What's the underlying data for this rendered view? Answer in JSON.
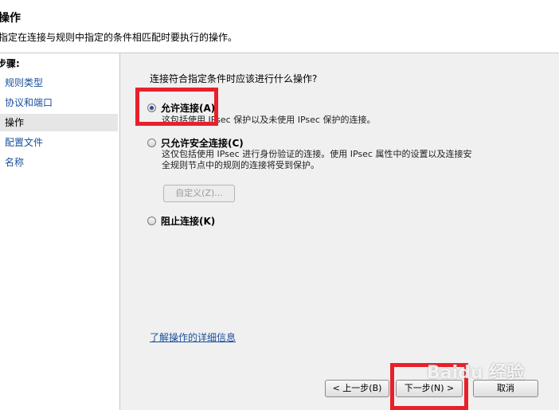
{
  "header": {
    "title": "操作",
    "description": "指定在连接与规则中指定的条件相匹配时要执行的操作。"
  },
  "sidebar": {
    "steps_label": "步骤:",
    "items": [
      {
        "label": "规则类型",
        "active": false
      },
      {
        "label": "协议和端口",
        "active": false
      },
      {
        "label": "操作",
        "active": true
      },
      {
        "label": "配置文件",
        "active": false
      },
      {
        "label": "名称",
        "active": false
      }
    ]
  },
  "main": {
    "question": "连接符合指定条件时应该进行什么操作?",
    "options": [
      {
        "label": "允许连接(A)",
        "checked": true,
        "description": "这包括使用 IPsec 保护以及未使用 IPsec 保护的连接。"
      },
      {
        "label": "只允许安全连接(C)",
        "checked": false,
        "description_line1": "这仅包括使用 IPsec 进行身份验证的连接。使用 IPsec 属性中的设置以及连接安",
        "description_line2": "全规则节点中的规则的连接将受到保护。"
      },
      {
        "label": "阻止连接(K)",
        "checked": false
      }
    ],
    "customize_label": "自定义(Z)...",
    "learn_more": "了解操作的详细信息"
  },
  "footer": {
    "back_label": "< 上一步(B)",
    "next_label": "下一步(N) >",
    "cancel_label": "取消"
  },
  "watermark": "Baidu 经验",
  "colors": {
    "highlight": "#e8202a",
    "link": "#1a4e9b"
  }
}
